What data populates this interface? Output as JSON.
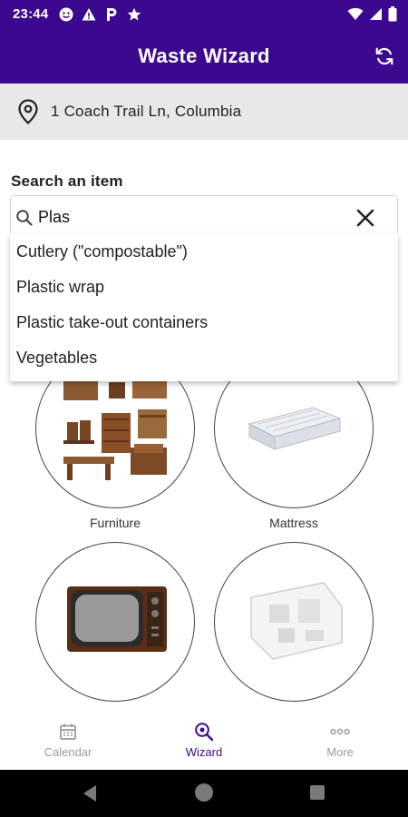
{
  "status_bar": {
    "time": "23:44",
    "left_icons": [
      "face-icon",
      "warning-icon",
      "parking-icon",
      "star-icon"
    ],
    "right_icons": [
      "wifi-icon",
      "signal-icon",
      "battery-icon"
    ]
  },
  "app_bar": {
    "title": "Waste Wizard",
    "refresh_icon": "refresh-icon",
    "background": "#3d0890"
  },
  "address": {
    "icon": "location-pin-icon",
    "text": "1 Coach Trail Ln, Columbia"
  },
  "search": {
    "label": "Search an item",
    "value": "Plas",
    "clear_icon": "close-icon",
    "suggestions": [
      "Cutlery (\"compostable\")",
      "Plastic wrap",
      "Plastic take-out containers",
      "Vegetables"
    ]
  },
  "categories": [
    {
      "label": "Furniture",
      "icon": "furniture-image"
    },
    {
      "label": "Mattress",
      "icon": "mattress-image"
    },
    {
      "label": "",
      "icon": "television-image"
    },
    {
      "label": "",
      "icon": "foam-packaging-image"
    }
  ],
  "bottom_nav": {
    "items": [
      {
        "label": "Calendar",
        "icon": "calendar-icon",
        "active": false
      },
      {
        "label": "Wizard",
        "icon": "wizard-search-icon",
        "active": true
      },
      {
        "label": "More",
        "icon": "more-dots-icon",
        "active": false
      }
    ]
  },
  "colors": {
    "primary": "#3d0890",
    "address_bg": "#e8e8e8",
    "inactive_nav": "#9a9a9a"
  }
}
